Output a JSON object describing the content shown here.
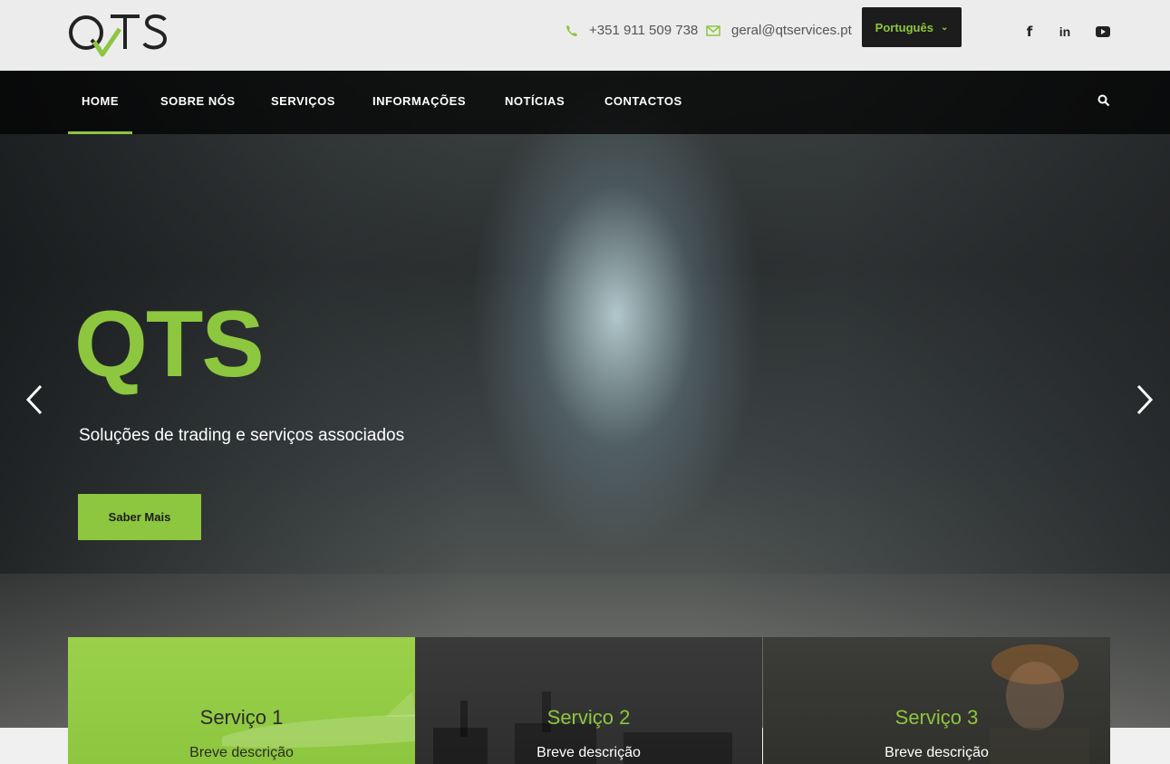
{
  "header": {
    "brand": "QTS",
    "phone": "+351 911 509 738",
    "email": "geral@qtservices.pt",
    "language": "Português",
    "social": [
      "facebook-icon",
      "linkedin-icon",
      "youtube-icon"
    ],
    "linkedin_label": "in"
  },
  "nav": {
    "items": [
      "HOME",
      "SOBRE NÓS",
      "SERVIÇOS",
      "INFORMAÇÕES",
      "NOTÍCIAS",
      "CONTACTOS"
    ],
    "active": "HOME"
  },
  "hero": {
    "title": "QTS",
    "subtitle": "Soluções de trading e serviços associados",
    "button": "Saber Mais"
  },
  "services": [
    {
      "title": "Serviço 1",
      "description": "Breve descrição"
    },
    {
      "title": "Serviço 2",
      "description": "Breve descrição"
    },
    {
      "title": "Serviço 3",
      "description": "Breve descrição"
    }
  ],
  "colors": {
    "accent": "#8dc63f",
    "dark": "#1c1c1c"
  }
}
